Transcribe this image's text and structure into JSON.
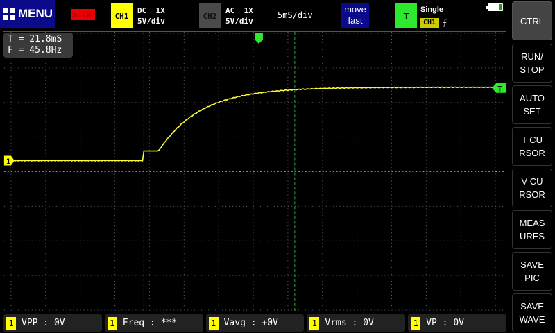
{
  "header": {
    "menu_label": "MENU",
    "run_state": "STOP",
    "ch1": {
      "label": "CH1",
      "coupling": "DC  1X",
      "scale": "5V/div",
      "color": "#ffff00"
    },
    "ch2": {
      "label": "CH2",
      "coupling": "AC  1X",
      "scale": "5V/div",
      "color": "#4a4a4a"
    },
    "timebase": "5mS/div",
    "move_line1": "move",
    "move_line2": "fast",
    "trigger": {
      "label": "T",
      "mode": "Single",
      "source": "CH1",
      "edge": "⨍",
      "color": "#2ee82e"
    },
    "battery_icon": "battery-icon"
  },
  "readout": {
    "t": "T = 21.8mS",
    "f": "F = 45.8Hz"
  },
  "markers": {
    "ch1": "1",
    "trigger": "T"
  },
  "sidebar": [
    {
      "label": "CTRL"
    },
    {
      "label": "RUN/\nSTOP"
    },
    {
      "label": "AUTO\nSET"
    },
    {
      "label": "T CU\nRSOR"
    },
    {
      "label": "V CU\nRSOR"
    },
    {
      "label": "MEAS\nURES"
    },
    {
      "label": "SAVE\nPIC"
    },
    {
      "label": "SAVE\nWAVE"
    }
  ],
  "measurements": [
    {
      "ch": "1",
      "label": "VPP : 0V"
    },
    {
      "ch": "1",
      "label": "Freq : ***"
    },
    {
      "ch": "1",
      "label": "Vavg : +0V"
    },
    {
      "ch": "1",
      "label": "Vrms : 0V"
    },
    {
      "ch": "1",
      "label": "VP  : 0V"
    }
  ]
}
